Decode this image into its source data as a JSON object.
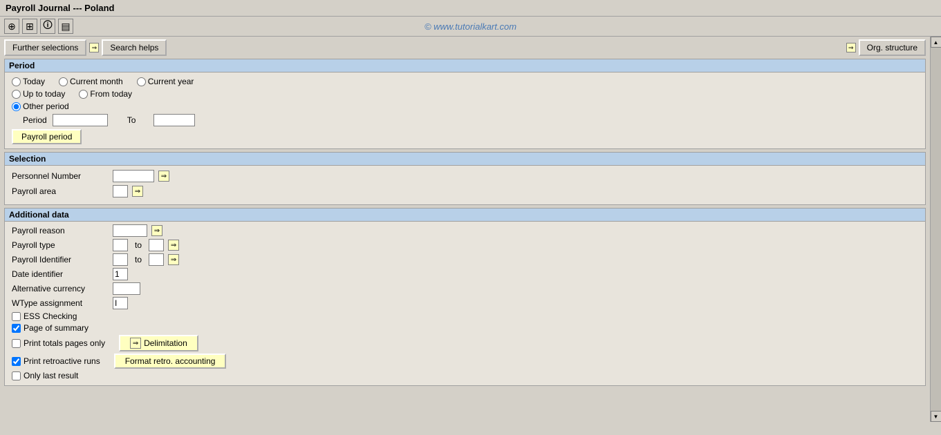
{
  "title": "Payroll Journal --- Poland",
  "watermark": "© www.tutorialkart.com",
  "toolbar": {
    "icons": [
      "⊕",
      "⊞",
      "🛈",
      "▤"
    ]
  },
  "buttons": {
    "further_selections": "Further selections",
    "search_helps": "Search helps",
    "org_structure": "Org. structure"
  },
  "period_section": {
    "header": "Period",
    "options": [
      {
        "id": "today",
        "label": "Today",
        "checked": false
      },
      {
        "id": "up_to_today",
        "label": "Up to today",
        "checked": false
      },
      {
        "id": "other_period",
        "label": "Other period",
        "checked": true
      },
      {
        "id": "current_month",
        "label": "Current month",
        "checked": false
      },
      {
        "id": "from_today",
        "label": "From today",
        "checked": false
      },
      {
        "id": "current_year",
        "label": "Current year",
        "checked": false
      }
    ],
    "period_label": "Period",
    "to_label": "To",
    "period_value": "",
    "to_value": "",
    "payroll_period_btn": "Payroll period"
  },
  "selection_section": {
    "header": "Selection",
    "fields": [
      {
        "label": "Personnel Number",
        "value": "",
        "wide": true
      },
      {
        "label": "Payroll area",
        "value": "",
        "wide": false
      }
    ]
  },
  "additional_section": {
    "header": "Additional data",
    "fields": [
      {
        "label": "Payroll reason",
        "value": "",
        "show_arrow": true,
        "show_to": false
      },
      {
        "label": "Payroll type",
        "value": "",
        "show_to": true,
        "to_value": ""
      },
      {
        "label": "Payroll Identifier",
        "value": "",
        "show_to": true,
        "to_value": ""
      },
      {
        "label": "Date identifier",
        "value": "1",
        "show_to": false
      },
      {
        "label": "Alternative currency",
        "value": "",
        "show_to": false
      },
      {
        "label": "WType assignment",
        "value": "I",
        "show_to": false
      }
    ],
    "checkboxes": [
      {
        "label": "ESS Checking",
        "checked": false
      },
      {
        "label": "Page of summary",
        "checked": true
      },
      {
        "label": "Print totals pages only",
        "checked": false
      },
      {
        "label": "Print retroactive runs",
        "checked": true
      },
      {
        "label": "Only last result",
        "checked": false
      }
    ],
    "btn_delimitation": "Delimitation",
    "btn_format": "Format retro. accounting"
  },
  "scrollbar": {
    "up_arrow": "▲",
    "down_arrow": "▼"
  }
}
